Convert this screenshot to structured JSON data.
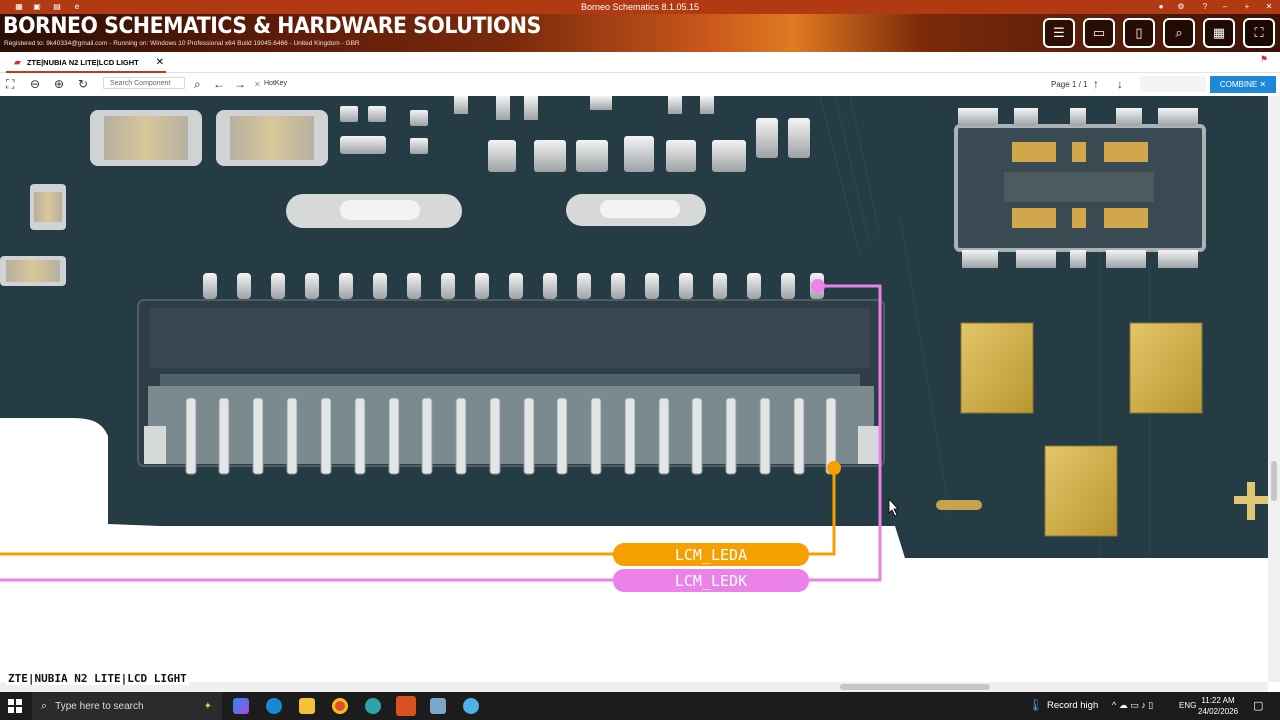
{
  "window": {
    "title": "Borneo Schematics 8.1.05.15"
  },
  "banner": {
    "brand": "BORNEO SCHEMATICS & HARDWARE SOLUTIONS",
    "registered": "Registered to: 9k40334@gmail.com - Running on: Windows 10 Professional x64 Build 19045.6466 - United Kingdom - GBR"
  },
  "tab": {
    "label": "ZTE|NUBIA N2 LITE|LCD LIGHT",
    "close": "✕"
  },
  "toolbar": {
    "search_placeholder": "Search Component",
    "hotkey": "HotKey",
    "page_label": "Page 1 / 1",
    "combine_label": "COMBINE ✕"
  },
  "board": {
    "net_labels": [
      {
        "name": "LCM_LEDA",
        "color": "#f5a000"
      },
      {
        "name": "LCM_LEDK",
        "color": "#ea82ea"
      }
    ]
  },
  "footer": {
    "label": "ZTE|NUBIA N2 LITE|LCD LIGHT"
  },
  "taskbar": {
    "search_placeholder": "Type here to search",
    "record": "Record high",
    "lang": "ENG",
    "time": "11:22 AM",
    "date": "24/02/2026"
  },
  "colors": {
    "accent": "#1e88d8",
    "titlebar": "#b23a12",
    "pcb": "#263c45"
  }
}
